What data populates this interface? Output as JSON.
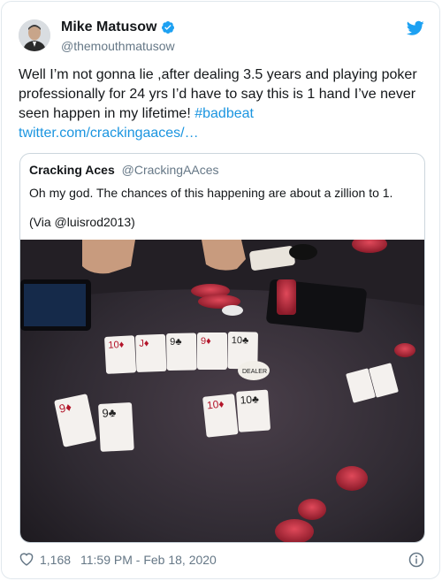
{
  "author": {
    "name": "Mike Matusow",
    "handle": "@themouthmatusow",
    "verified": true
  },
  "tweet": {
    "text": "Well I’m not gonna lie ,after dealing 3.5 years and playing poker professionally for 24 yrs I’d have to say this is 1 hand I’ve never seen happen in my lifetime!",
    "hashtag": "#badbeat",
    "link": "twitter.com/crackingaaces/…"
  },
  "quoted": {
    "name": "Cracking Aces",
    "handle": "@CrackingAAces",
    "text": "Oh my god. The chances of this happening are about a zillion to 1.",
    "via": "(Via @luisrod2013)"
  },
  "photo": {
    "dealer_button": "DEALER",
    "board_cards": [
      "10♦",
      "J♦",
      "9♣",
      "9♦",
      "10♣"
    ],
    "player_left_cards": [
      "9♦",
      "9♣"
    ],
    "player_center_cards": [
      "10♦",
      "10♣"
    ]
  },
  "footer": {
    "likes": "1,168",
    "timestamp": "11:59 PM - Feb 18, 2020"
  },
  "colors": {
    "accent": "#1da1f2",
    "link": "#1b95e0",
    "heart": "#657786"
  }
}
